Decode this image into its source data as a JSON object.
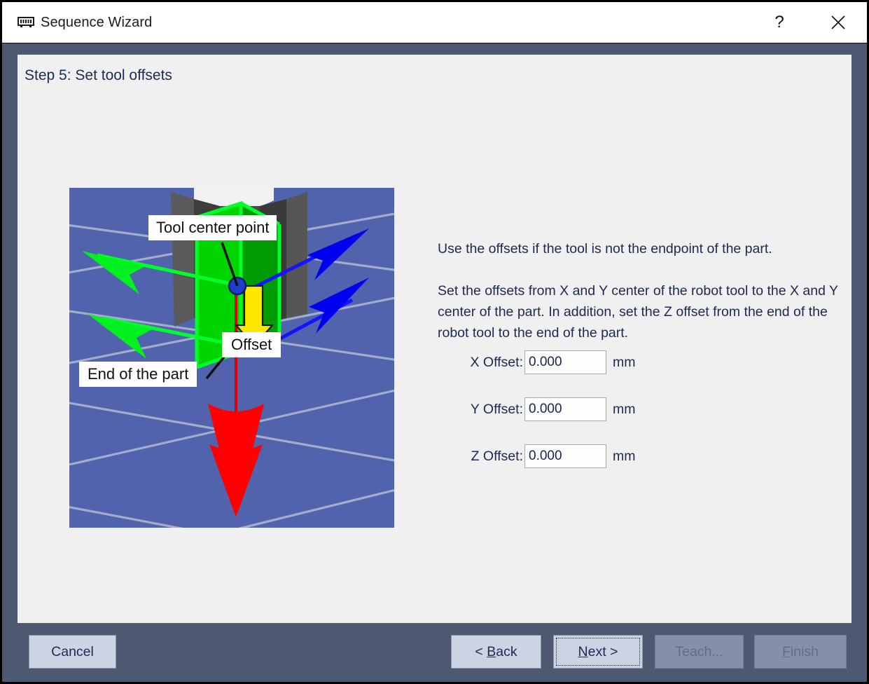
{
  "window": {
    "title": "Sequence Wizard",
    "icon": "memory-chip-icon",
    "help_label": "?",
    "close_label": "close-icon",
    "frame_color": "#4d5871",
    "panel_color": "#f0f0f0"
  },
  "step": {
    "title": "Step 5: Set tool offsets"
  },
  "description": {
    "paragraph1": "Use the offsets if the tool is not the endpoint of the part.",
    "paragraph2": "Set the offsets from X and Y center of the robot tool to the X and Y center of the part.  In addition, set the Z offset from the end of the robot tool to the end of the part."
  },
  "offsets": {
    "unit": "mm",
    "fields": [
      {
        "label": "X Offset:",
        "value": "0.000",
        "unit": "mm"
      },
      {
        "label": "Y Offset:",
        "value": "0.000",
        "unit": "mm"
      },
      {
        "label": "Z Offset:",
        "value": "0.000",
        "unit": "mm"
      }
    ]
  },
  "illustration": {
    "background_color": "#5263ad",
    "grid_color": "#b6bcd6",
    "annotations": [
      {
        "name": "tool-center-point-callout",
        "text": "Tool center point"
      },
      {
        "name": "offset-callout",
        "text": "Offset"
      },
      {
        "name": "end-of-part-callout",
        "text": "End of the part"
      }
    ],
    "axis_colors": {
      "x_axis_green": "#00e000",
      "y_axis_blue": "#0000ff",
      "z_axis_red": "#ff0000",
      "offset_arrow_yellow": "#ffe600",
      "marker_blue": "#1d3ecc",
      "tool_body_gray": "#4a4a4a",
      "part_green": "#00cc00"
    }
  },
  "footer": {
    "buttons": [
      {
        "name": "cancel-button",
        "label": "Cancel",
        "enabled": true,
        "focused": false,
        "mnemonic": ""
      },
      {
        "name": "back-button",
        "label": "< Back",
        "enabled": true,
        "focused": false,
        "mnemonic": "B"
      },
      {
        "name": "next-button",
        "label": "Next >",
        "enabled": true,
        "focused": true,
        "mnemonic": "N"
      },
      {
        "name": "teach-button",
        "label": "Teach...",
        "enabled": false,
        "focused": false,
        "mnemonic": ""
      },
      {
        "name": "finish-button",
        "label": "Finish",
        "enabled": false,
        "focused": false,
        "mnemonic": "F"
      }
    ]
  }
}
